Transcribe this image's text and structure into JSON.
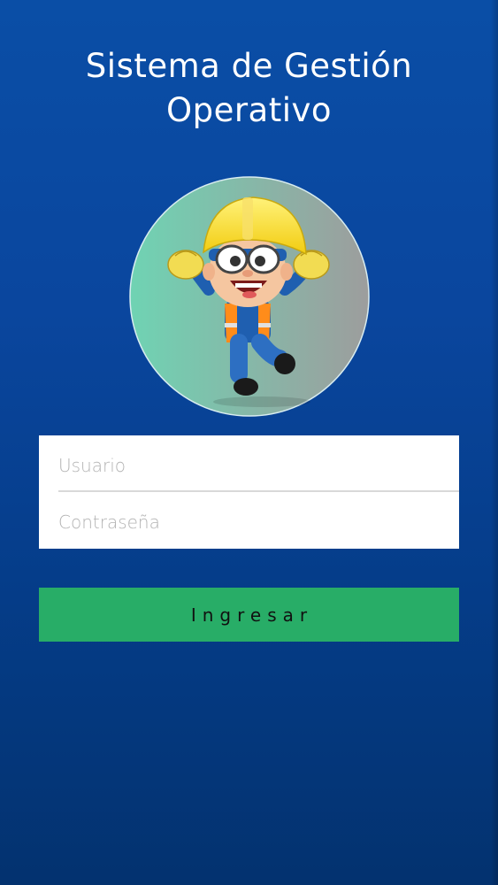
{
  "header": {
    "title_line1": "Sistema de Gestión",
    "title_line2": "Operativo"
  },
  "avatar": {
    "icon": "construction-worker-mascot-icon",
    "circle_gradient": [
      "#6fd3b3",
      "#9b9b9b"
    ]
  },
  "login": {
    "username_placeholder": "Usuario",
    "username_value": "",
    "password_placeholder": "Contraseña",
    "password_value": "",
    "submit_label": "Ingresar"
  },
  "colors": {
    "background_top": "#0a4ea6",
    "background_bottom": "#03326f",
    "button": "#28ad67",
    "card": "#ffffff"
  }
}
